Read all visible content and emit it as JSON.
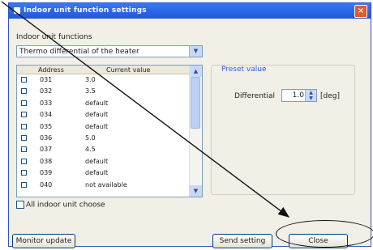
{
  "window": {
    "title": "Indoor unit function settings",
    "close_glyph": "×"
  },
  "functions": {
    "group_label": "Indoor unit functions",
    "selected": "Thermo differential of the heater",
    "dropdown_arrow": "▼"
  },
  "list": {
    "headers": {
      "address": "Address",
      "value": "Current value"
    },
    "rows": [
      {
        "address": "031",
        "value": "3.0"
      },
      {
        "address": "032",
        "value": "3.5"
      },
      {
        "address": "033",
        "value": "default"
      },
      {
        "address": "034",
        "value": "default"
      },
      {
        "address": "035",
        "value": "default"
      },
      {
        "address": "036",
        "value": "5.0"
      },
      {
        "address": "037",
        "value": "4.5"
      },
      {
        "address": "038",
        "value": "default"
      },
      {
        "address": "039",
        "value": "default"
      },
      {
        "address": "040",
        "value": "not available"
      }
    ],
    "scroll_up": "▲",
    "scroll_down": "▼"
  },
  "all_choose": {
    "label": "All indoor unit choose"
  },
  "preset": {
    "group_label": "Preset value",
    "differential_label": "Differential",
    "differential_value": "1.0",
    "unit": "[deg]",
    "spin_up": "▲",
    "spin_down": "▼"
  },
  "buttons": {
    "monitor_update": "Monitor update",
    "send_setting": "Send setting",
    "close": "Close"
  }
}
